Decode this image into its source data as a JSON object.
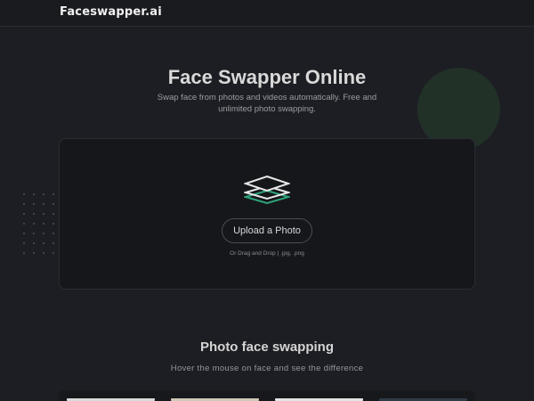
{
  "header": {
    "logo_text": "Faceswapper.ai"
  },
  "hero": {
    "title": "Face Swapper Online",
    "subtitle": "Swap face from photos and videos automatically. Free and unlimited photo swapping."
  },
  "upload": {
    "icon": "layers-icon",
    "button_label": "Upload a Photo",
    "hint": "Or Drag and Drop | .jpg, .png"
  },
  "section": {
    "title": "Photo face swapping",
    "subtitle": "Hover the mouse on face and see the difference"
  },
  "colors": {
    "background": "#1d1e23",
    "card": "#15171b",
    "accent_green": "#2fa37a",
    "deco_circle": "#213128"
  }
}
